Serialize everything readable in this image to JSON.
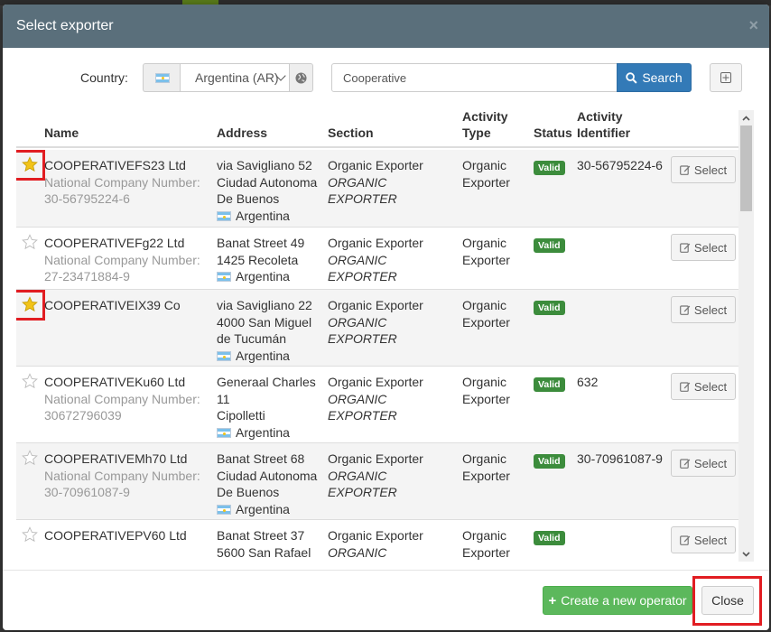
{
  "dialog": {
    "title": "Select exporter",
    "close_glyph": "×"
  },
  "search": {
    "country_label": "Country:",
    "country_value": "Argentina (AR)",
    "query": "Cooperative",
    "search_button": "Search"
  },
  "table": {
    "headers": {
      "name": "Name",
      "address": "Address",
      "section": "Section",
      "activity_type_1": "Activity",
      "activity_type_2": "Type",
      "status": "Status",
      "activity_id_1": "Activity",
      "activity_id_2": "Identifier"
    },
    "select_label": "Select",
    "rows": [
      {
        "favorite": true,
        "highlighted": true,
        "name": "COOPERATIVEFS23 Ltd",
        "company_number_label": "National Company Number:",
        "company_number": "30-56795224-6",
        "address": [
          "via Savigliano 52",
          "Ciudad Autonoma",
          "De Buenos"
        ],
        "country": "Argentina",
        "section": "Organic Exporter",
        "section_upper": "ORGANIC EXPORTER",
        "activity_type": [
          "Organic",
          "Exporter"
        ],
        "status": "Valid",
        "activity_id": "30-56795224-6"
      },
      {
        "favorite": false,
        "highlighted": false,
        "name": "COOPERATIVEFg22 Ltd",
        "company_number_label": "National Company Number:",
        "company_number": "27-23471884-9",
        "address": [
          "Banat Street 49",
          "1425 Recoleta"
        ],
        "country": "Argentina",
        "section": "Organic Exporter",
        "section_upper": "ORGANIC EXPORTER",
        "activity_type": [
          "Organic",
          "Exporter"
        ],
        "status": "Valid",
        "activity_id": ""
      },
      {
        "favorite": true,
        "highlighted": true,
        "name": "COOPERATIVEIX39 Co",
        "company_number_label": "",
        "company_number": "",
        "address": [
          "via Savigliano 22",
          "4000 San Miguel",
          "de Tucumán"
        ],
        "country": "Argentina",
        "section": "Organic Exporter",
        "section_upper": "ORGANIC EXPORTER",
        "activity_type": [
          "Organic",
          "Exporter"
        ],
        "status": "Valid",
        "activity_id": ""
      },
      {
        "favorite": false,
        "highlighted": false,
        "name": "COOPERATIVEKu60 Ltd",
        "company_number_label": "National Company Number:",
        "company_number": "30672796039",
        "address": [
          "Generaal Charles",
          "11",
          "Cipolletti"
        ],
        "country": "Argentina",
        "section": "Organic Exporter",
        "section_upper": "ORGANIC EXPORTER",
        "activity_type": [
          "Organic",
          "Exporter"
        ],
        "status": "Valid",
        "activity_id": "632"
      },
      {
        "favorite": false,
        "highlighted": false,
        "name": "COOPERATIVEMh70 Ltd",
        "company_number_label": "National Company Number:",
        "company_number": "30-70961087-9",
        "address": [
          "Banat Street 68",
          "Ciudad Autonoma",
          "De Buenos"
        ],
        "country": "Argentina",
        "section": "Organic Exporter",
        "section_upper": "ORGANIC EXPORTER",
        "activity_type": [
          "Organic",
          "Exporter"
        ],
        "status": "Valid",
        "activity_id": "30-70961087-9"
      },
      {
        "favorite": false,
        "highlighted": false,
        "name": "COOPERATIVEPV60 Ltd",
        "company_number_label": "",
        "company_number": "",
        "address": [
          "Banat Street 37",
          "5600 San Rafael"
        ],
        "country": "",
        "section": "Organic Exporter",
        "section_upper": "ORGANIC EXPORTER",
        "activity_type": [
          "Organic",
          "Exporter"
        ],
        "status": "Valid",
        "activity_id": ""
      }
    ]
  },
  "footer": {
    "create_button": "Create a new operator",
    "close_button": "Close"
  },
  "colors": {
    "header_bg": "#5a6f7b",
    "primary": "#337ab7",
    "success": "#5cb85c",
    "badge": "#3c8c3c",
    "highlight": "#e11d22",
    "star_fill": "#f2c318"
  }
}
